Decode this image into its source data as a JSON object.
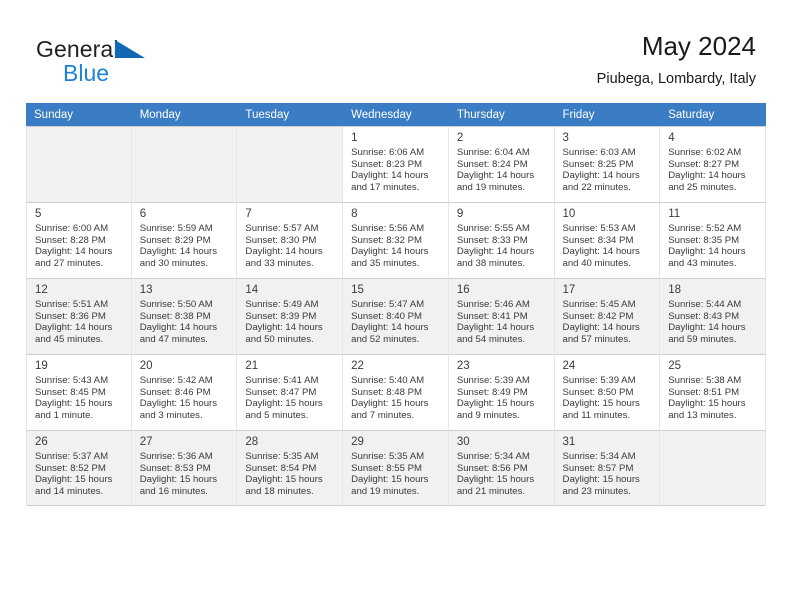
{
  "brand": {
    "name_top": "General",
    "name_bottom": "Blue",
    "logo_color": "#1268b3",
    "accent_color": "#1d83d4"
  },
  "header": {
    "title": "May 2024",
    "location": "Piubega, Lombardy, Italy"
  },
  "calendar": {
    "header_bg": "#3b7dc4",
    "weekday_headers": [
      "Sunday",
      "Monday",
      "Tuesday",
      "Wednesday",
      "Thursday",
      "Friday",
      "Saturday"
    ],
    "weeks": [
      [
        {
          "day": "",
          "info": ""
        },
        {
          "day": "",
          "info": ""
        },
        {
          "day": "",
          "info": ""
        },
        {
          "day": "1",
          "info": "Sunrise: 6:06 AM\nSunset: 8:23 PM\nDaylight: 14 hours\nand 17 minutes."
        },
        {
          "day": "2",
          "info": "Sunrise: 6:04 AM\nSunset: 8:24 PM\nDaylight: 14 hours\nand 19 minutes."
        },
        {
          "day": "3",
          "info": "Sunrise: 6:03 AM\nSunset: 8:25 PM\nDaylight: 14 hours\nand 22 minutes."
        },
        {
          "day": "4",
          "info": "Sunrise: 6:02 AM\nSunset: 8:27 PM\nDaylight: 14 hours\nand 25 minutes."
        }
      ],
      [
        {
          "day": "5",
          "info": "Sunrise: 6:00 AM\nSunset: 8:28 PM\nDaylight: 14 hours\nand 27 minutes."
        },
        {
          "day": "6",
          "info": "Sunrise: 5:59 AM\nSunset: 8:29 PM\nDaylight: 14 hours\nand 30 minutes."
        },
        {
          "day": "7",
          "info": "Sunrise: 5:57 AM\nSunset: 8:30 PM\nDaylight: 14 hours\nand 33 minutes."
        },
        {
          "day": "8",
          "info": "Sunrise: 5:56 AM\nSunset: 8:32 PM\nDaylight: 14 hours\nand 35 minutes."
        },
        {
          "day": "9",
          "info": "Sunrise: 5:55 AM\nSunset: 8:33 PM\nDaylight: 14 hours\nand 38 minutes."
        },
        {
          "day": "10",
          "info": "Sunrise: 5:53 AM\nSunset: 8:34 PM\nDaylight: 14 hours\nand 40 minutes."
        },
        {
          "day": "11",
          "info": "Sunrise: 5:52 AM\nSunset: 8:35 PM\nDaylight: 14 hours\nand 43 minutes."
        }
      ],
      [
        {
          "day": "12",
          "info": "Sunrise: 5:51 AM\nSunset: 8:36 PM\nDaylight: 14 hours\nand 45 minutes."
        },
        {
          "day": "13",
          "info": "Sunrise: 5:50 AM\nSunset: 8:38 PM\nDaylight: 14 hours\nand 47 minutes."
        },
        {
          "day": "14",
          "info": "Sunrise: 5:49 AM\nSunset: 8:39 PM\nDaylight: 14 hours\nand 50 minutes."
        },
        {
          "day": "15",
          "info": "Sunrise: 5:47 AM\nSunset: 8:40 PM\nDaylight: 14 hours\nand 52 minutes."
        },
        {
          "day": "16",
          "info": "Sunrise: 5:46 AM\nSunset: 8:41 PM\nDaylight: 14 hours\nand 54 minutes."
        },
        {
          "day": "17",
          "info": "Sunrise: 5:45 AM\nSunset: 8:42 PM\nDaylight: 14 hours\nand 57 minutes."
        },
        {
          "day": "18",
          "info": "Sunrise: 5:44 AM\nSunset: 8:43 PM\nDaylight: 14 hours\nand 59 minutes."
        }
      ],
      [
        {
          "day": "19",
          "info": "Sunrise: 5:43 AM\nSunset: 8:45 PM\nDaylight: 15 hours\nand 1 minute."
        },
        {
          "day": "20",
          "info": "Sunrise: 5:42 AM\nSunset: 8:46 PM\nDaylight: 15 hours\nand 3 minutes."
        },
        {
          "day": "21",
          "info": "Sunrise: 5:41 AM\nSunset: 8:47 PM\nDaylight: 15 hours\nand 5 minutes."
        },
        {
          "day": "22",
          "info": "Sunrise: 5:40 AM\nSunset: 8:48 PM\nDaylight: 15 hours\nand 7 minutes."
        },
        {
          "day": "23",
          "info": "Sunrise: 5:39 AM\nSunset: 8:49 PM\nDaylight: 15 hours\nand 9 minutes."
        },
        {
          "day": "24",
          "info": "Sunrise: 5:39 AM\nSunset: 8:50 PM\nDaylight: 15 hours\nand 11 minutes."
        },
        {
          "day": "25",
          "info": "Sunrise: 5:38 AM\nSunset: 8:51 PM\nDaylight: 15 hours\nand 13 minutes."
        }
      ],
      [
        {
          "day": "26",
          "info": "Sunrise: 5:37 AM\nSunset: 8:52 PM\nDaylight: 15 hours\nand 14 minutes."
        },
        {
          "day": "27",
          "info": "Sunrise: 5:36 AM\nSunset: 8:53 PM\nDaylight: 15 hours\nand 16 minutes."
        },
        {
          "day": "28",
          "info": "Sunrise: 5:35 AM\nSunset: 8:54 PM\nDaylight: 15 hours\nand 18 minutes."
        },
        {
          "day": "29",
          "info": "Sunrise: 5:35 AM\nSunset: 8:55 PM\nDaylight: 15 hours\nand 19 minutes."
        },
        {
          "day": "30",
          "info": "Sunrise: 5:34 AM\nSunset: 8:56 PM\nDaylight: 15 hours\nand 21 minutes."
        },
        {
          "day": "31",
          "info": "Sunrise: 5:34 AM\nSunset: 8:57 PM\nDaylight: 15 hours\nand 23 minutes."
        },
        {
          "day": "",
          "info": ""
        }
      ]
    ]
  }
}
